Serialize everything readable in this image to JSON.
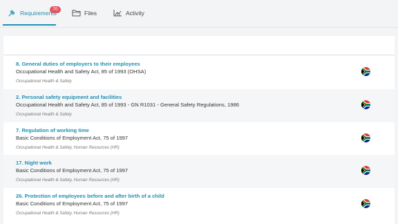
{
  "tabs": [
    {
      "label": "Requirements",
      "icon": "gavel-icon",
      "active": true,
      "badge": "70"
    },
    {
      "label": "Files",
      "icon": "folder-icon",
      "active": false
    },
    {
      "label": "Activity",
      "icon": "chart-icon",
      "active": false
    }
  ],
  "accent": "#1f8fb3",
  "badge_color": "#e0555f",
  "requirements": [
    {
      "title": "8. General duties of employers to their employees",
      "act": "Occupational Health and Safety Act, 85 of 1993 (OHSA)",
      "category": "Occupational Health & Safety",
      "flag": "south-africa-flag-icon"
    },
    {
      "title": "2. Personal safety equipment and facilities",
      "act": "Occupational Health and Safety Act, 85 of 1993 - GN R1031 - General Safety Regulations, 1986",
      "category": "Occupational Health & Safety",
      "flag": "south-africa-flag-icon"
    },
    {
      "title": "7. Regulation of working time",
      "act": "Basic Conditions of Employment Act, 75 of 1997",
      "category": "Occupational Health & Safety, Human Resources (HR)",
      "flag": "south-africa-flag-icon"
    },
    {
      "title": "17. Night work",
      "act": "Basic Conditions of Employment Act, 75 of 1997",
      "category": "Occupational Health & Safety, Human Resources (HR)",
      "flag": "south-africa-flag-icon"
    },
    {
      "title": "26. Protection of employees before and after birth of a child",
      "act": "Basic Conditions of Employment Act, 75 of 1997",
      "category": "Occupational Health & Safety, Human Resources (HR)",
      "flag": "south-africa-flag-icon"
    }
  ]
}
